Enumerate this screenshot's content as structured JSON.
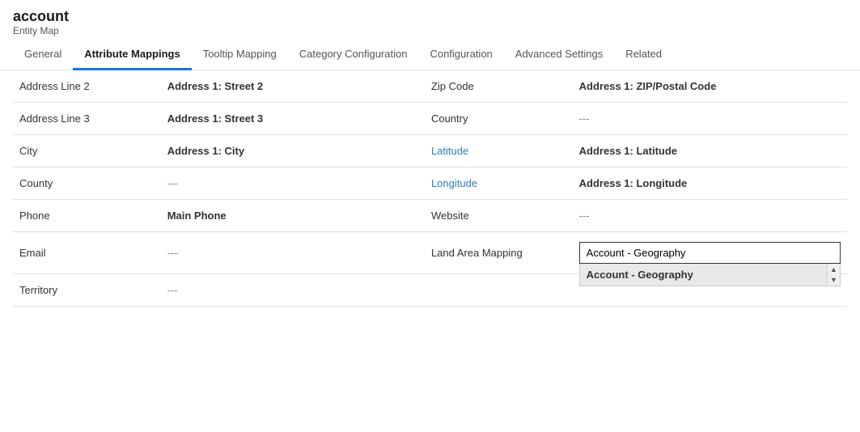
{
  "header": {
    "title": "account",
    "subtitle": "Entity Map"
  },
  "tabs": [
    {
      "id": "general",
      "label": "General",
      "active": false
    },
    {
      "id": "attribute-mappings",
      "label": "Attribute Mappings",
      "active": true
    },
    {
      "id": "tooltip-mapping",
      "label": "Tooltip Mapping",
      "active": false
    },
    {
      "id": "category-configuration",
      "label": "Category Configuration",
      "active": false
    },
    {
      "id": "configuration",
      "label": "Configuration",
      "active": false
    },
    {
      "id": "advanced-settings",
      "label": "Advanced Settings",
      "active": false
    },
    {
      "id": "related",
      "label": "Related",
      "active": false
    }
  ],
  "rows": [
    {
      "left_label": "Address Line 2",
      "left_label_link": false,
      "left_value": "Address 1: Street 2",
      "left_empty": false,
      "right_label": "Zip Code",
      "right_label_link": false,
      "right_value": "Address 1: ZIP/Postal Code",
      "right_empty": false,
      "right_input": false
    },
    {
      "left_label": "Address Line 3",
      "left_label_link": false,
      "left_value": "Address 1: Street 3",
      "left_empty": false,
      "right_label": "Country",
      "right_label_link": false,
      "right_value": "---",
      "right_empty": true,
      "right_input": false
    },
    {
      "left_label": "City",
      "left_label_link": false,
      "left_value": "Address 1: City",
      "left_empty": false,
      "right_label": "Latitude",
      "right_label_link": true,
      "right_value": "Address 1: Latitude",
      "right_empty": false,
      "right_input": false
    },
    {
      "left_label": "County",
      "left_label_link": false,
      "left_value": "---",
      "left_empty": true,
      "right_label": "Longitude",
      "right_label_link": true,
      "right_value": "Address 1: Longitude",
      "right_empty": false,
      "right_input": false
    },
    {
      "left_label": "Phone",
      "left_label_link": false,
      "left_value": "Main Phone",
      "left_empty": false,
      "right_label": "Website",
      "right_label_link": false,
      "right_value": "---",
      "right_empty": true,
      "right_input": false
    },
    {
      "left_label": "Email",
      "left_label_link": false,
      "left_value": "---",
      "left_empty": true,
      "right_label": "Land Area Mapping",
      "right_label_link": false,
      "right_value": "Account - Geography",
      "right_empty": false,
      "right_input": true,
      "dropdown_option": "Account - Geography"
    },
    {
      "left_label": "Territory",
      "left_label_link": false,
      "left_value": "---",
      "left_empty": true,
      "right_label": "",
      "right_label_link": false,
      "right_value": "",
      "right_empty": true,
      "right_input": false
    }
  ],
  "dropdown": {
    "input_value": "Account - Geography",
    "option": "Account - Geography"
  }
}
